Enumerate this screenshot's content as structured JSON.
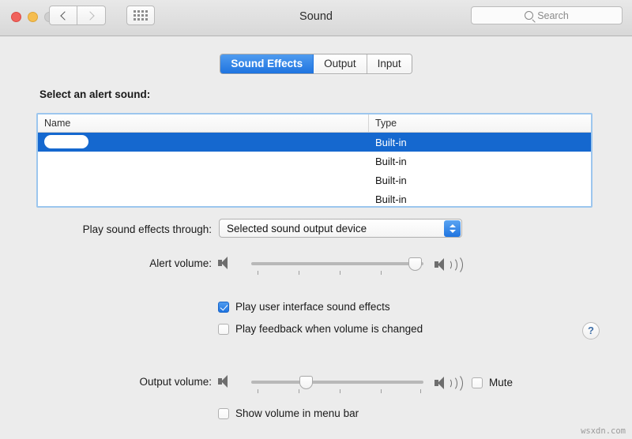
{
  "window": {
    "title": "Sound",
    "traffic_lights": [
      "close",
      "minimize",
      "zoom"
    ],
    "back_icon": "chevron-left-icon",
    "forward_icon": "chevron-right-icon",
    "grid_icon": "show-all-grid-icon",
    "search": {
      "icon": "search-icon",
      "placeholder": "Search",
      "value": ""
    }
  },
  "tabs": [
    {
      "label": "Sound Effects",
      "selected": true
    },
    {
      "label": "Output",
      "selected": false
    },
    {
      "label": "Input",
      "selected": false
    }
  ],
  "alert_sounds": {
    "section_label": "Select an alert sound:",
    "columns": [
      "Name",
      "Type"
    ],
    "rows": [
      {
        "name": "",
        "type": "Built-in",
        "selected": true
      },
      {
        "name": "",
        "type": "Built-in",
        "selected": false
      },
      {
        "name": "",
        "type": "Built-in",
        "selected": false
      },
      {
        "name": "",
        "type": "Built-in",
        "selected": false
      }
    ]
  },
  "play_through": {
    "label": "Play sound effects through:",
    "value": "Selected sound output device",
    "stepper_icon": "chevron-up-down-icon"
  },
  "alert_volume": {
    "label": "Alert volume:",
    "value_percent": 95,
    "min_icon": "speaker-quiet-icon",
    "max_icon": "speaker-loud-icon",
    "tick_count": 4
  },
  "output_volume": {
    "label": "Output volume:",
    "value_percent": 29,
    "min_icon": "speaker-quiet-icon",
    "max_icon": "speaker-loud-icon",
    "tick_count": 5
  },
  "checkboxes": {
    "ui_sound_effects": {
      "label": "Play user interface sound effects",
      "checked": true
    },
    "volume_feedback": {
      "label": "Play feedback when volume is changed",
      "checked": false
    },
    "mute": {
      "label": "Mute",
      "checked": false
    },
    "show_volume_menu_bar": {
      "label": "Show volume in menu bar",
      "checked": false
    }
  },
  "help_button": {
    "label": "?",
    "icon": "help-question-icon"
  },
  "watermark": "wsxdn.com",
  "colors": {
    "accent_blue": "#1f74e0",
    "selection_blue": "#1568cf",
    "window_bg": "#ececec",
    "focus_ring": "#9cc6ee"
  }
}
